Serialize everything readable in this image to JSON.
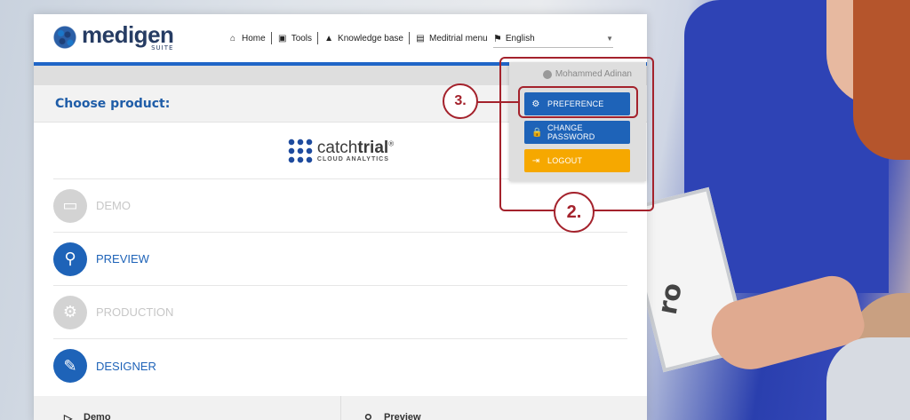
{
  "brand": {
    "name": "medigen",
    "sub": "SUITE"
  },
  "nav": [
    {
      "icon": "home-icon",
      "glyph": "⌂",
      "label": "Home"
    },
    {
      "icon": "toolbox-icon",
      "glyph": "▣",
      "label": "Tools"
    },
    {
      "icon": "graduation-cap-icon",
      "glyph": "▲",
      "label": "Knowledge base"
    },
    {
      "icon": "id-card-icon",
      "glyph": "▤",
      "label": "Meditrial menu"
    }
  ],
  "language": {
    "selected": "English"
  },
  "main": {
    "heading": "Choose product:",
    "product": {
      "name_light": "catch",
      "name_bold": "trial",
      "reg": "®",
      "sub": "CLOUD ANALYTICS"
    },
    "options": [
      {
        "label": "DEMO",
        "active": false,
        "icon": "monitor-icon",
        "glyph": "▭"
      },
      {
        "label": "PREVIEW",
        "active": true,
        "icon": "search-icon",
        "glyph": "⚲"
      },
      {
        "label": "PRODUCTION",
        "active": false,
        "icon": "gear-icon",
        "glyph": "⚙"
      },
      {
        "label": "DESIGNER",
        "active": true,
        "icon": "edit-icon",
        "glyph": "✎"
      }
    ],
    "footer": [
      {
        "label": "Demo",
        "glyph": "▷"
      },
      {
        "label": "Preview",
        "glyph": "⚲"
      }
    ]
  },
  "user_menu": {
    "username": "Mohammed Adinan",
    "items": [
      {
        "label": "PREFERENCE",
        "glyph": "⚙",
        "color": "#1e63b8"
      },
      {
        "label": "CHANGE PASSWORD",
        "glyph": "🔒",
        "color": "#1e63b8"
      },
      {
        "label": "LOGOUT",
        "glyph": "⇥",
        "color": "#f6a800"
      }
    ]
  },
  "annotations": {
    "step_preference": "3.",
    "step_menu": "2."
  },
  "colors": {
    "accent": "#1e63b8",
    "annotation": "#a4222c",
    "logout": "#f6a800"
  }
}
